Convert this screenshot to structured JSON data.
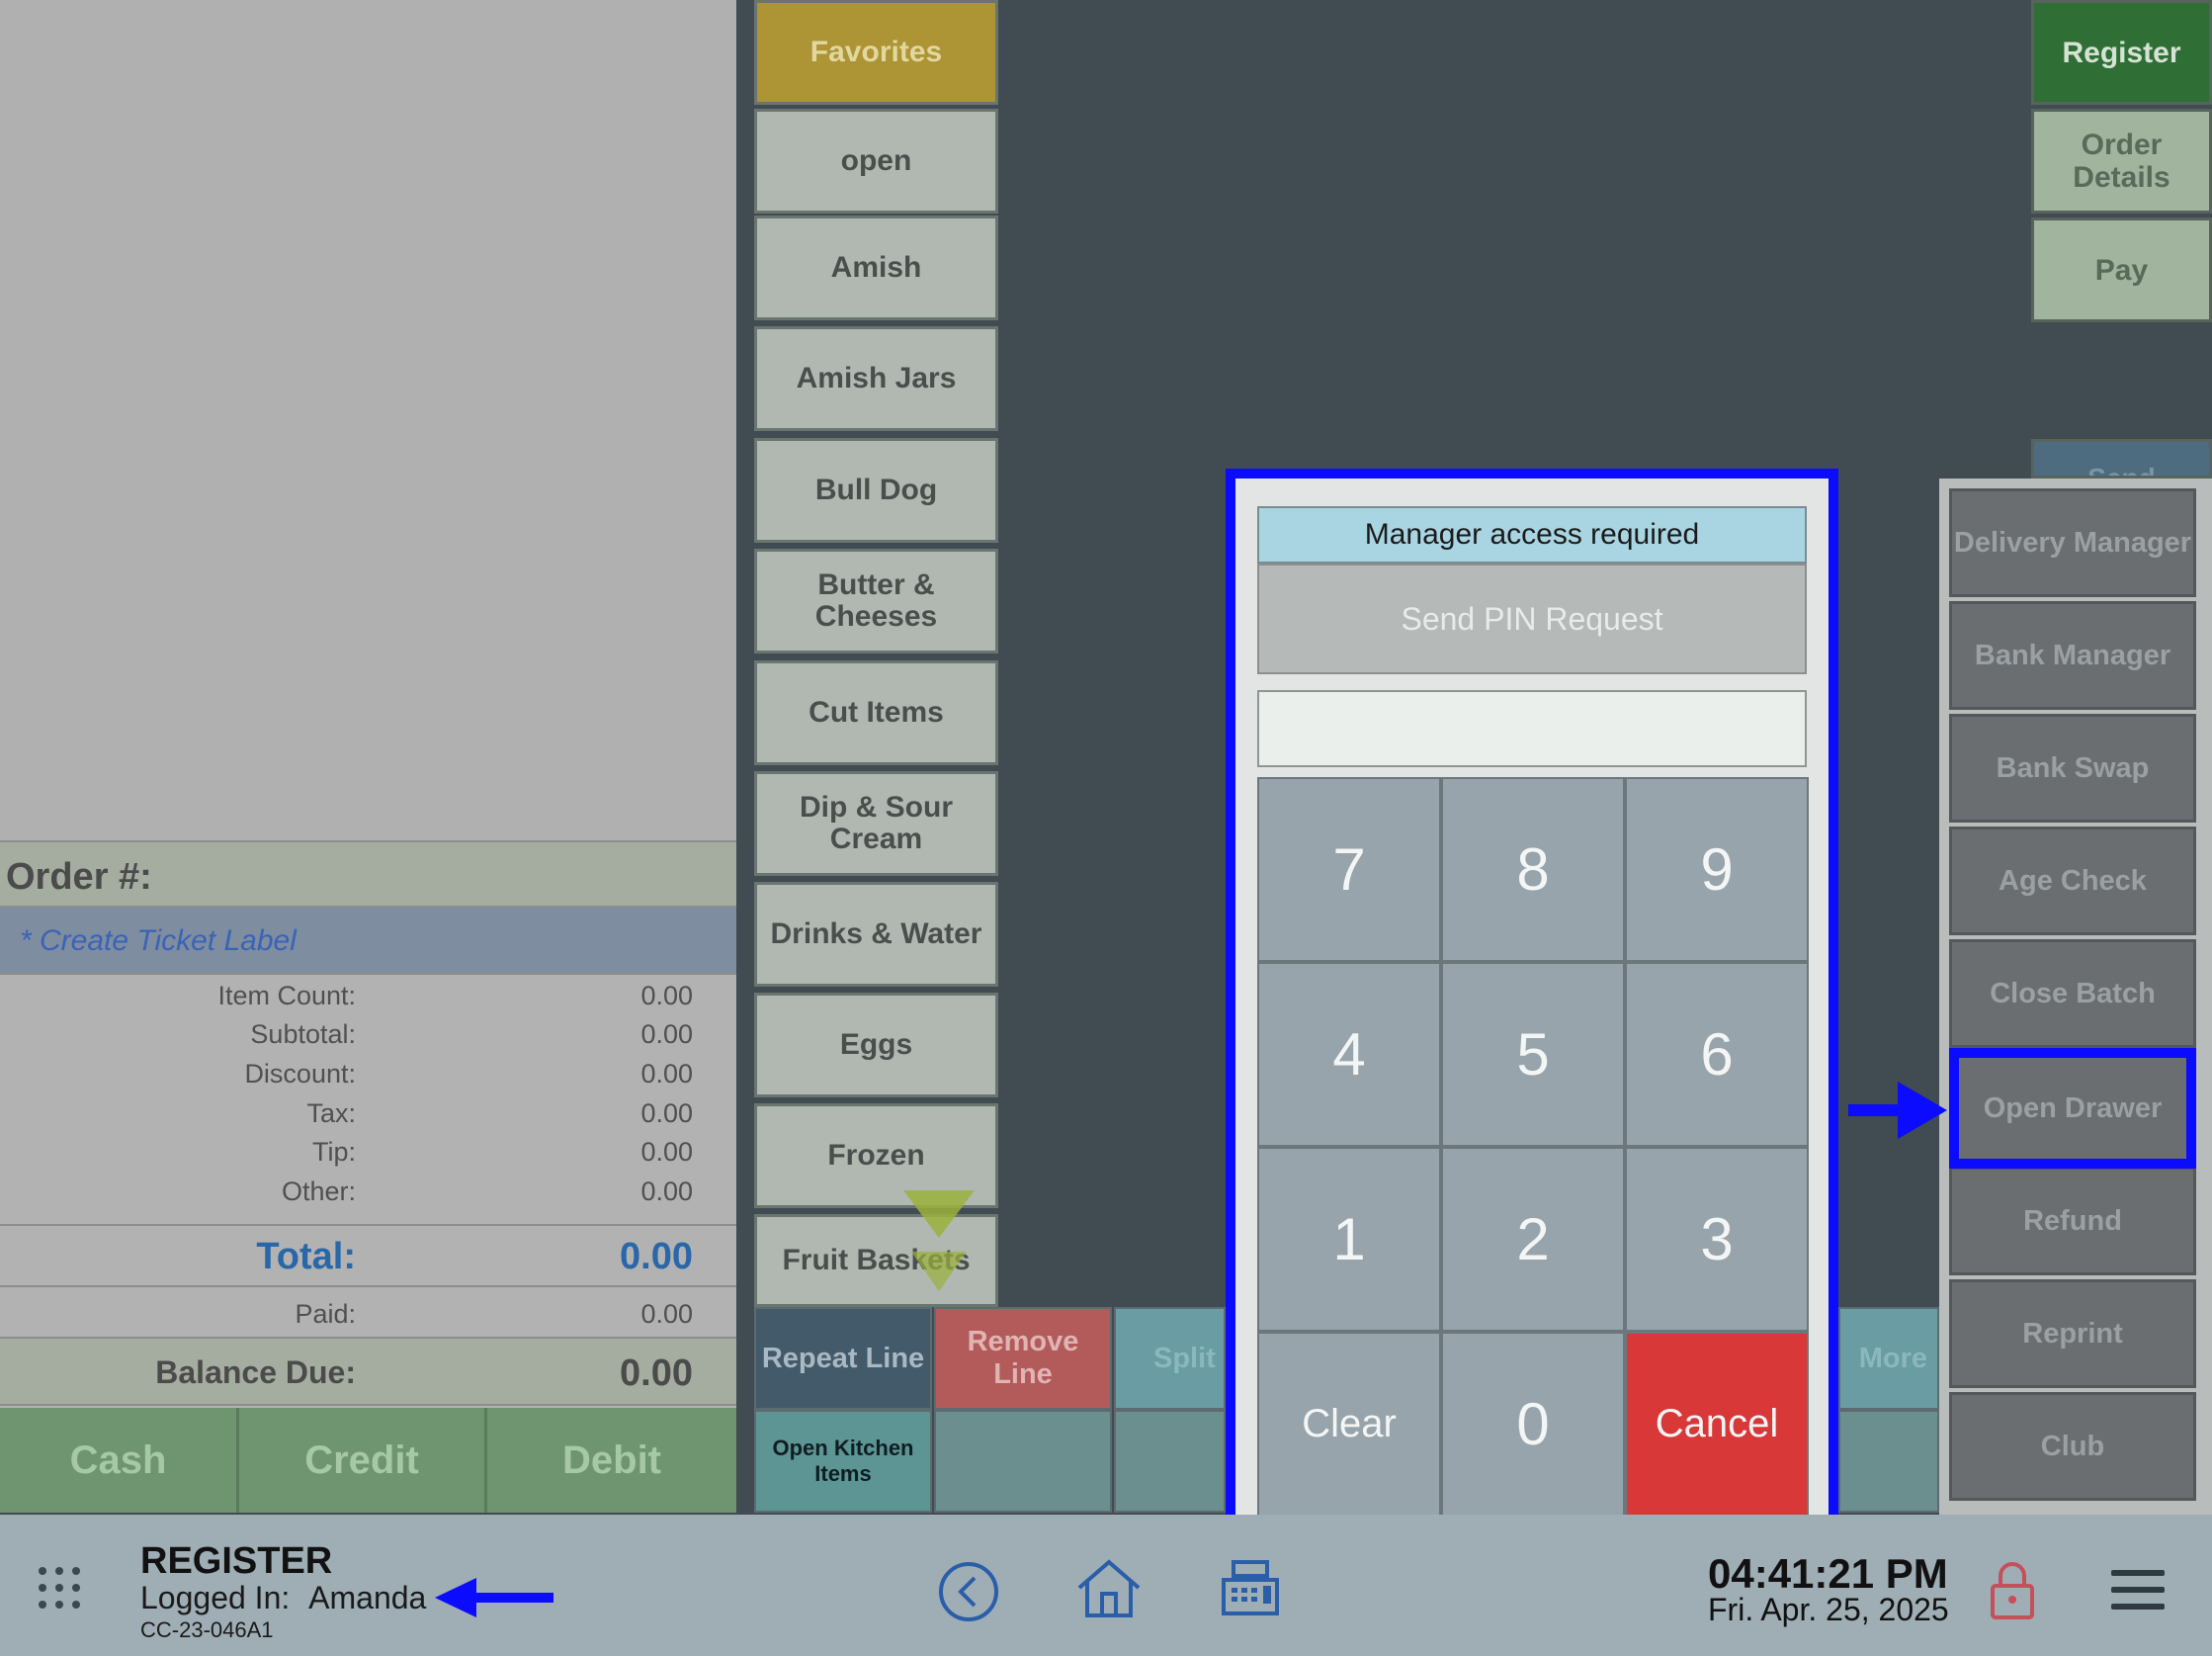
{
  "order": {
    "number_label": "Order #:",
    "ticket_label": "* Create Ticket Label",
    "rows": [
      {
        "label": "Item Count:",
        "value": "0.00"
      },
      {
        "label": "Subtotal:",
        "value": "0.00"
      },
      {
        "label": "Discount:",
        "value": "0.00"
      },
      {
        "label": "Tax:",
        "value": "0.00"
      },
      {
        "label": "Tip:",
        "value": "0.00"
      },
      {
        "label": "Other:",
        "value": "0.00"
      }
    ],
    "total_label": "Total:",
    "total_value": "0.00",
    "paid_label": "Paid:",
    "paid_value": "0.00",
    "balance_label": "Balance Due:",
    "balance_value": "0.00"
  },
  "tender": {
    "cash": "Cash",
    "credit": "Credit",
    "debit": "Debit"
  },
  "categories": [
    "Favorites",
    "open",
    "Amish",
    "Amish Jars",
    "Bull Dog",
    "Butter & Cheeses",
    "Cut Items",
    "Dip & Sour Cream",
    "Drinks & Water",
    "Eggs",
    "Frozen",
    "Fruit Baskets"
  ],
  "functions": {
    "repeat_line": "Repeat Line",
    "remove_line": "Remove Line",
    "split_partial": "Split By Item",
    "more_partial": "More",
    "open_kitchen": "Open Kitchen Items"
  },
  "right": {
    "register": "Register",
    "order_details": "Order Details",
    "pay": "Pay",
    "send_partial": "Send"
  },
  "side_menu": [
    "Delivery Manager",
    "Bank Manager",
    "Bank Swap",
    "Age Check",
    "Close Batch",
    "Open Drawer",
    "Refund",
    "Reprint",
    "Club"
  ],
  "pin_dialog": {
    "title": "Manager access required",
    "send_pin": "Send PIN Request",
    "keys": [
      "7",
      "8",
      "9",
      "4",
      "5",
      "6",
      "1",
      "2",
      "3",
      "Clear",
      "0",
      "Cancel"
    ],
    "input_value": ""
  },
  "footer": {
    "title": "REGISTER",
    "logged_in_label": "Logged In:",
    "user": "Amanda",
    "device_id": "CC-23-046A1",
    "time": "04:41:21 PM",
    "date": "Fri. Apr. 25, 2025"
  },
  "colors": {
    "highlight": "#0a0bff",
    "register_active": "#2f6e35",
    "cancel": "#d93838",
    "favorites": "#ad9434"
  }
}
